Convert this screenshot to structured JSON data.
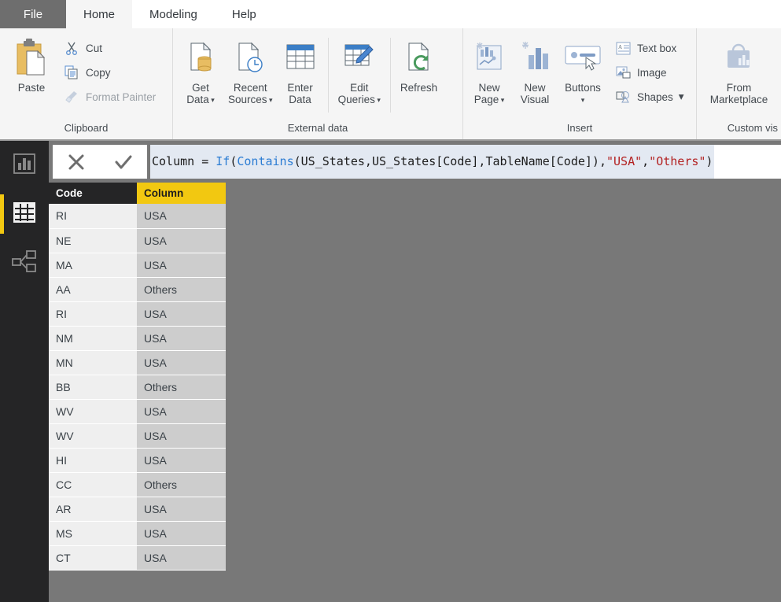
{
  "tabs": [
    {
      "label": "File",
      "state": "file"
    },
    {
      "label": "Home",
      "state": "active"
    },
    {
      "label": "Modeling",
      "state": "normal"
    },
    {
      "label": "Help",
      "state": "normal"
    }
  ],
  "ribbon": {
    "groups": [
      {
        "name": "clipboard",
        "label": "Clipboard",
        "big": [
          {
            "label": "Paste",
            "icon": "paste-icon"
          }
        ],
        "small": [
          {
            "label": "Cut",
            "icon": "cut-icon",
            "disabled": false
          },
          {
            "label": "Copy",
            "icon": "copy-icon",
            "disabled": false
          },
          {
            "label": "Format Painter",
            "icon": "format-painter-icon",
            "disabled": true
          }
        ]
      },
      {
        "name": "external-data",
        "label": "External data",
        "big": [
          {
            "label": "Get\nData",
            "icon": "get-data-icon",
            "caret": true
          },
          {
            "label": "Recent\nSources",
            "icon": "recent-sources-icon",
            "caret": true
          },
          {
            "label": "Enter\nData",
            "icon": "enter-data-icon",
            "caret": false
          },
          {
            "label": "Edit\nQueries",
            "icon": "edit-queries-icon",
            "caret": true
          },
          {
            "label": "Refresh",
            "icon": "refresh-icon",
            "caret": false
          }
        ]
      },
      {
        "name": "insert",
        "label": "Insert",
        "big": [
          {
            "label": "New\nPage",
            "icon": "new-page-icon",
            "caret": true
          },
          {
            "label": "New\nVisual",
            "icon": "new-visual-icon",
            "caret": false
          },
          {
            "label": "Buttons",
            "icon": "buttons-icon",
            "caret": true
          }
        ],
        "small": [
          {
            "label": "Text box",
            "icon": "text-box-icon",
            "disabled": false
          },
          {
            "label": "Image",
            "icon": "image-icon",
            "disabled": false
          },
          {
            "label": "Shapes",
            "icon": "shapes-icon",
            "disabled": false,
            "caret": true
          }
        ]
      },
      {
        "name": "custom-visuals",
        "label": "Custom vis",
        "big": [
          {
            "label": "From\nMarketplace",
            "icon": "marketplace-icon",
            "caret": false
          }
        ]
      }
    ]
  },
  "viewbar": {
    "items": [
      {
        "name": "report-view",
        "icon": "report-chart-icon",
        "selected": false
      },
      {
        "name": "data-view",
        "icon": "data-table-icon",
        "selected": true
      },
      {
        "name": "model-view",
        "icon": "model-relationship-icon",
        "selected": false
      }
    ]
  },
  "formula_bar": {
    "cancel_icon": "cancel-x-icon",
    "accept_icon": "accept-check-icon",
    "segments": [
      {
        "text": "Column = ",
        "kind": "plain"
      },
      {
        "text": "If",
        "kind": "fn"
      },
      {
        "text": "(",
        "kind": "plain"
      },
      {
        "text": "Contains",
        "kind": "fn"
      },
      {
        "text": "(US_States,US_States[Code],TableName[Code]),",
        "kind": "plain"
      },
      {
        "text": "\"USA\"",
        "kind": "str"
      },
      {
        "text": ",",
        "kind": "plain"
      },
      {
        "text": "\"Others\"",
        "kind": "str"
      },
      {
        "text": ")",
        "kind": "plain"
      }
    ],
    "full_text": "Column = If(Contains(US_States,US_States[Code],TableName[Code]),\"USA\",\"Others\")"
  },
  "table": {
    "columns": [
      {
        "key": "code",
        "label": "Code",
        "selected": false
      },
      {
        "key": "column",
        "label": "Column",
        "selected": true
      }
    ],
    "rows": [
      {
        "code": "RI",
        "column": "USA"
      },
      {
        "code": "NE",
        "column": "USA"
      },
      {
        "code": "MA",
        "column": "USA"
      },
      {
        "code": "AA",
        "column": "Others"
      },
      {
        "code": "RI",
        "column": "USA"
      },
      {
        "code": "NM",
        "column": "USA"
      },
      {
        "code": "MN",
        "column": "USA"
      },
      {
        "code": "BB",
        "column": "Others"
      },
      {
        "code": "WV",
        "column": "USA"
      },
      {
        "code": "WV",
        "column": "USA"
      },
      {
        "code": "HI",
        "column": "USA"
      },
      {
        "code": "CC",
        "column": "Others"
      },
      {
        "code": "AR",
        "column": "USA"
      },
      {
        "code": "MS",
        "column": "USA"
      },
      {
        "code": "CT",
        "column": "USA"
      }
    ]
  },
  "colors": {
    "accent_yellow": "#f2c811",
    "sidebar_dark": "#252526",
    "canvas_gray": "#787878",
    "ribbon_bg": "#f5f5f5",
    "formula_function": "#2b7cd3",
    "formula_string": "#b32121"
  }
}
